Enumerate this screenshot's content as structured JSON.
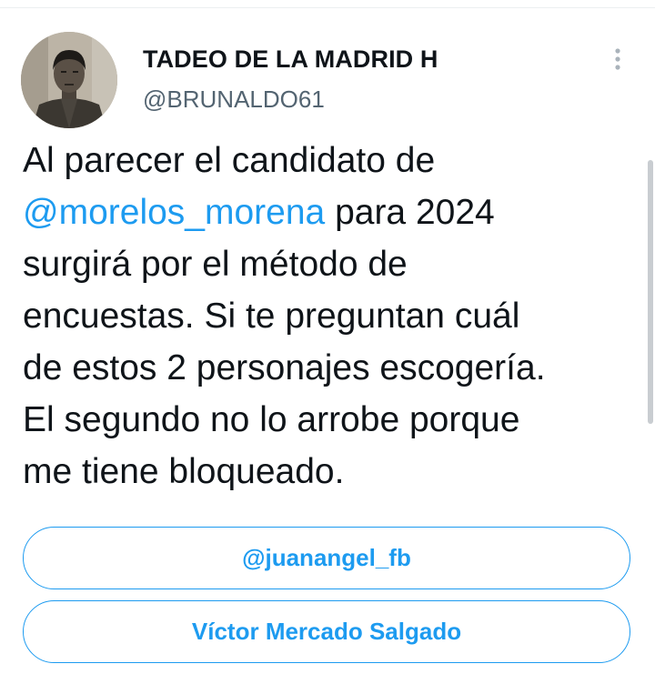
{
  "author": {
    "display_name": "TADEO DE LA MADRID H",
    "handle": "@BRUNALDO61"
  },
  "tweet": {
    "lines": [
      {
        "text": "Al parecer el candidato de"
      },
      {
        "mention": "@morelos_morena",
        "text": " para 2024"
      },
      {
        "text": "surgirá por el método de"
      },
      {
        "text": "encuestas. Si te preguntan cuál"
      },
      {
        "text": "de estos 2 personajes escogería."
      },
      {
        "text": "El segundo no lo arrobe porque"
      },
      {
        "text": "me tiene bloqueado."
      }
    ]
  },
  "poll": {
    "options": [
      {
        "label": "@juanangel_fb"
      },
      {
        "label": "Víctor Mercado Salgado"
      }
    ]
  },
  "colors": {
    "accent": "#1d9bf0",
    "text": "#0f1419",
    "secondary": "#536471"
  },
  "icons": {
    "more": "more-vertical-icon",
    "avatar": "avatar-photo"
  }
}
